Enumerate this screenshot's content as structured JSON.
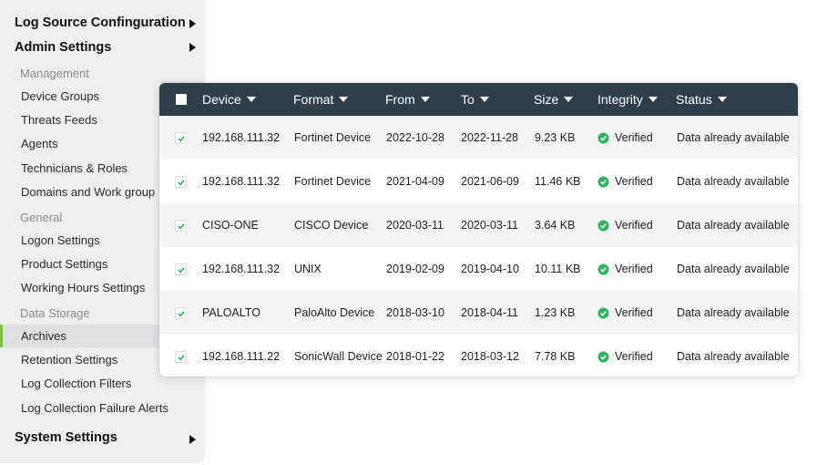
{
  "sidebar": {
    "sections": [
      {
        "label": "Log Source Confinguration",
        "expandable": true
      },
      {
        "label": "Admin Settings",
        "expandable": true
      },
      {
        "label": "System Settings",
        "expandable": true
      }
    ],
    "groups": [
      {
        "label": "Management",
        "items": [
          "Device Groups",
          "Threats Feeds",
          "Agents",
          "Technicians & Roles",
          "Domains and Work group"
        ]
      },
      {
        "label": "General",
        "items": [
          "Logon Settings",
          "Product Settings",
          "Working Hours Settings"
        ]
      },
      {
        "label": "Data Storage",
        "items": [
          "Archives",
          "Retention Settings",
          "Log Collection Filters",
          "Log Collection Failure Alerts"
        ]
      }
    ],
    "active_item": "Archives",
    "active_color": "#7cc242"
  },
  "table": {
    "select_all_checked": false,
    "columns": [
      {
        "label": "Device"
      },
      {
        "label": "Format"
      },
      {
        "label": "From"
      },
      {
        "label": "To"
      },
      {
        "label": "Size"
      },
      {
        "label": "Integrity"
      },
      {
        "label": "Status"
      }
    ],
    "header_bg": "#2f3f4a",
    "verified_color": "#2db55d",
    "rows": [
      {
        "checked": true,
        "device": "192.168.111.32",
        "format": "Fortinet Device",
        "from": "2022-10-28",
        "to": "2022-11-28",
        "size": "9.23 KB",
        "integrity": "Verified",
        "status": "Data already available"
      },
      {
        "checked": true,
        "device": "192.168.111.32",
        "format": "Fortinet Device",
        "from": "2021-04-09",
        "to": "2021-06-09",
        "size": "11.46 KB",
        "integrity": "Verified",
        "status": "Data already available"
      },
      {
        "checked": true,
        "device": "CISO-ONE",
        "format": "CISCO Device",
        "from": "2020-03-11",
        "to": "2020-03-11",
        "size": "3.64 KB",
        "integrity": "Verified",
        "status": "Data already available"
      },
      {
        "checked": true,
        "device": "192.168.111.32",
        "format": "UNIX",
        "from": "2019-02-09",
        "to": "2019-04-10",
        "size": "10.11 KB",
        "integrity": "Verified",
        "status": "Data already available"
      },
      {
        "checked": true,
        "device": "PALOALTO",
        "format": "PaloAlto Device",
        "from": "2018-03-10",
        "to": "2018-04-11",
        "size": "1.23 KB",
        "integrity": "Verified",
        "status": "Data already available"
      },
      {
        "checked": true,
        "device": "192.168.111.22",
        "format": "SonicWall Device",
        "from": "2018-01-22",
        "to": "2018-03-12",
        "size": "7.78 KB",
        "integrity": "Verified",
        "status": "Data already available"
      }
    ]
  }
}
